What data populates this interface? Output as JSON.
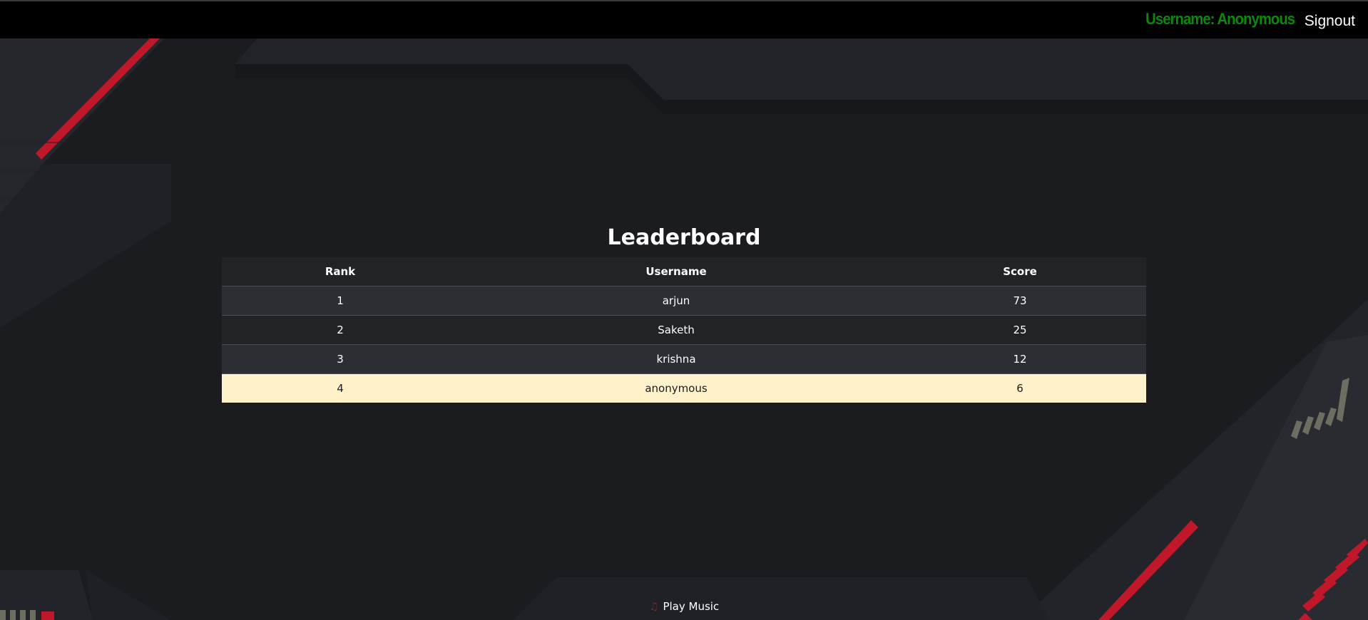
{
  "header": {
    "username_text": "Username: Anonymous",
    "signout_label": "Signout"
  },
  "main": {
    "title": "Leaderboard",
    "columns": [
      "Rank",
      "Username",
      "Score"
    ],
    "rows": [
      {
        "rank": "1",
        "username": "arjun",
        "score": "73"
      },
      {
        "rank": "2",
        "username": "Saketh",
        "score": "25"
      },
      {
        "rank": "3",
        "username": "krishna",
        "score": "12"
      },
      {
        "rank": "4",
        "username": "anonymous",
        "score": "6"
      }
    ],
    "highlighted_row_index": 3
  },
  "footer": {
    "music_label": "Play Music",
    "music_icon": "music-note-icon"
  },
  "colors": {
    "username_green": "#0a8a0a",
    "highlight_row": "#fff2cb",
    "accent_red": "#c0182a"
  }
}
